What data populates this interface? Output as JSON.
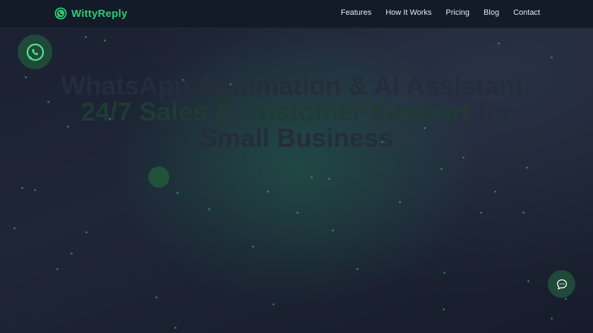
{
  "brand": {
    "name": "WittyReply",
    "icon": "whatsapp-icon"
  },
  "nav": {
    "links": [
      "Features",
      "How It Works",
      "Pricing",
      "Blog",
      "Contact"
    ]
  },
  "hero": {
    "title_line1": "WhatsApp Automation & AI Assistant:",
    "title_highlight": "24/7 Sales & Customer Support",
    "title_suffix": " for",
    "title_line3": "Small Business"
  },
  "floating": {
    "whatsapp_icon": "whatsapp-icon",
    "chat_icon": "chat-bubble-icon"
  },
  "colors": {
    "accent": "#2ecc71",
    "background": "#151b2a",
    "navbar": "#131a28"
  }
}
